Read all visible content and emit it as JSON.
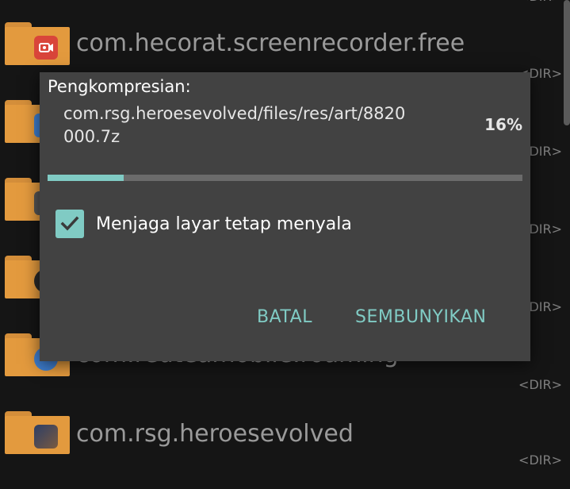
{
  "file_list": {
    "items": [
      {
        "name": "com.hecorat.screenrecorder.free",
        "icon": "screen-recorder-app-icon",
        "icon_color": "#d9453a",
        "dir": "<DIR>"
      },
      {
        "name": "",
        "icon": "app-icon",
        "icon_color": "#3f7fd0",
        "dir": "<DIR>"
      },
      {
        "name": "",
        "icon": "app-icon",
        "icon_color": "#555555",
        "dir": "<DIR>"
      },
      {
        "name": "",
        "icon": "app-icon",
        "icon_color": "#2a2a2a",
        "dir": "<DIR>"
      },
      {
        "name": "com.redteamobile.roaming",
        "icon": "roaming-app-icon",
        "icon_color": "#3f7fd0",
        "dir": "<DIR>"
      },
      {
        "name": "com.rsg.heroesevolved",
        "icon": "heroes-evolved-app-icon",
        "icon_color": "#3a4a6a",
        "dir": "<DIR>"
      }
    ]
  },
  "dialog": {
    "title": "Pengkompresian:",
    "path": "com.rsg.heroesevolved/files/res/art/8820000.7z",
    "percent_label": "16%",
    "progress": 0.16,
    "checkbox_label": "Menjaga layar tetap menyala",
    "checkbox_checked": true,
    "cancel_label": "BATAL",
    "hide_label": "SEMBUNYIKAN",
    "accent_color": "#80cbc4"
  }
}
